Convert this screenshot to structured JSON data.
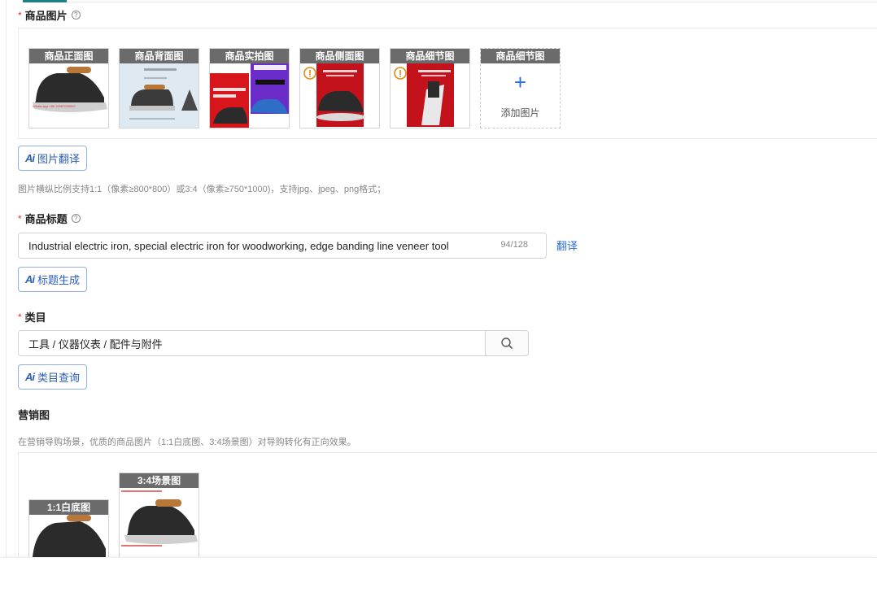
{
  "images_section": {
    "label": "商品图片",
    "required_mark": "*",
    "help_mark": "?",
    "thumbs": [
      {
        "caption": "商品正面图"
      },
      {
        "caption": "商品背面图"
      },
      {
        "caption": "商品实拍图"
      },
      {
        "caption": "商品侧面图"
      },
      {
        "caption": "商品细节图"
      }
    ],
    "add_caption": "商品细节图",
    "add_plus": "+",
    "add_label": "添加图片",
    "ai_button": "图片翻译",
    "hint": "图片横纵比例支持1:1（像素≥800*800）或3:4（像素≥750*1000)，支持jpg、jpeg、png格式；"
  },
  "title_section": {
    "label": "商品标题",
    "required_mark": "*",
    "help_mark": "?",
    "value": "Industrial electric iron, special electric iron for woodworking, edge banding line veneer tool",
    "counter": "94/128",
    "translate_link": "翻译",
    "ai_button": "标题生成"
  },
  "category_section": {
    "label": "类目",
    "required_mark": "*",
    "value": "工具 / 仪器仪表 / 配件与附件",
    "clear_mark": "×",
    "ai_button": "类目查询"
  },
  "marketing_section": {
    "label": "营销图",
    "hint": "在营销导购场景，优质的商品图片（1:1白底图、3:4场景图）对导购转化有正向效果。",
    "thumbs": [
      {
        "caption": "1:1白底图"
      },
      {
        "caption": "3:4场景图"
      }
    ]
  },
  "ai_icon_text": "Ai",
  "colors": {
    "accent": "#2c6fd6",
    "required": "#e0352b",
    "caption_bg": "#6b6b6b",
    "tab_indicator": "#1e7f88"
  }
}
